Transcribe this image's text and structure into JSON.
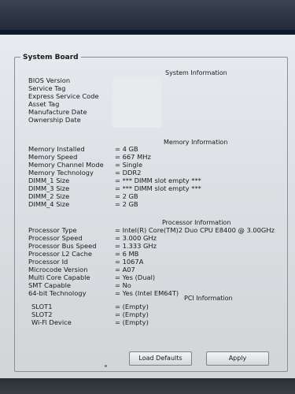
{
  "section_title": "System Board",
  "system_info": {
    "header": "System Information",
    "labels": [
      "BIOS Version",
      "Service Tag",
      "Express Service Code",
      "Asset Tag",
      "Manufacture Date",
      "Ownership Date"
    ]
  },
  "memory_info": {
    "header": "Memory Information",
    "rows": [
      {
        "label": "Memory Installed",
        "value": "= 4 GB"
      },
      {
        "label": "Memory Speed",
        "value": "= 667 MHz"
      },
      {
        "label": "Memory Channel Mode",
        "value": "= Single"
      },
      {
        "label": "Memory Technology",
        "value": "= DDR2"
      },
      {
        "label": "DIMM_1 Size",
        "value": "= *** DIMM slot empty ***"
      },
      {
        "label": "DIMM_3 Size",
        "value": "= *** DIMM slot empty ***"
      },
      {
        "label": "DIMM_2 Size",
        "value": "= 2 GB"
      },
      {
        "label": "DIMM_4 Size",
        "value": "= 2 GB"
      }
    ]
  },
  "processor_info": {
    "header": "Processor Information",
    "rows": [
      {
        "label": "Processor Type",
        "value": "= Intel(R) Core(TM)2 Duo CPU     E8400  @ 3.00GHz"
      },
      {
        "label": "Processor Speed",
        "value": "= 3.000 GHz"
      },
      {
        "label": "Processor Bus Speed",
        "value": "= 1.333 GHz"
      },
      {
        "label": "Processor L2 Cache",
        "value": "= 6 MB"
      },
      {
        "label": "Processor Id",
        "value": "= 1067A"
      },
      {
        "label": "Microcode Version",
        "value": "= A07"
      },
      {
        "label": "Multi Core Capable",
        "value": "= Yes (Dual)"
      },
      {
        "label": "SMT Capable",
        "value": "= No"
      },
      {
        "label": "64-bit Technology",
        "value": "= Yes (Intel EM64T)"
      }
    ]
  },
  "pci_info": {
    "header": "PCI Information",
    "rows": [
      {
        "label": "SLOT1",
        "value": "= (Empty)"
      },
      {
        "label": "SLOT2",
        "value": "= (Empty)"
      },
      {
        "label": "Wi-Fi Device",
        "value": "= (Empty)"
      }
    ]
  },
  "buttons": {
    "load_defaults": "Load Defaults",
    "apply": "Apply"
  }
}
